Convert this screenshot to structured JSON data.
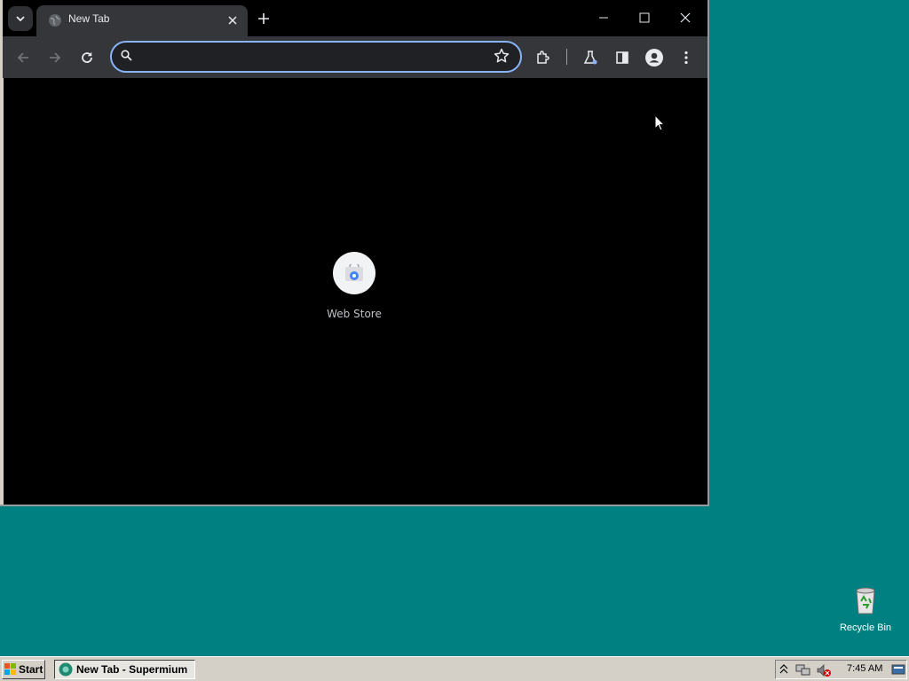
{
  "browser": {
    "tab": {
      "title": "New Tab"
    },
    "omnibox": {
      "value": "",
      "placeholder": ""
    },
    "shortcuts": [
      {
        "label": "Web Store"
      }
    ]
  },
  "desktop": {
    "icons": [
      {
        "label": "Recycle Bin"
      }
    ]
  },
  "taskbar": {
    "start_label": "Start",
    "task_label": "New Tab - Supermium",
    "clock": "7:45 AM"
  },
  "colors": {
    "desktop": "#008080",
    "toolbar": "#35363a",
    "omnibox_border": "#8ab4f8",
    "content": "#000000"
  }
}
